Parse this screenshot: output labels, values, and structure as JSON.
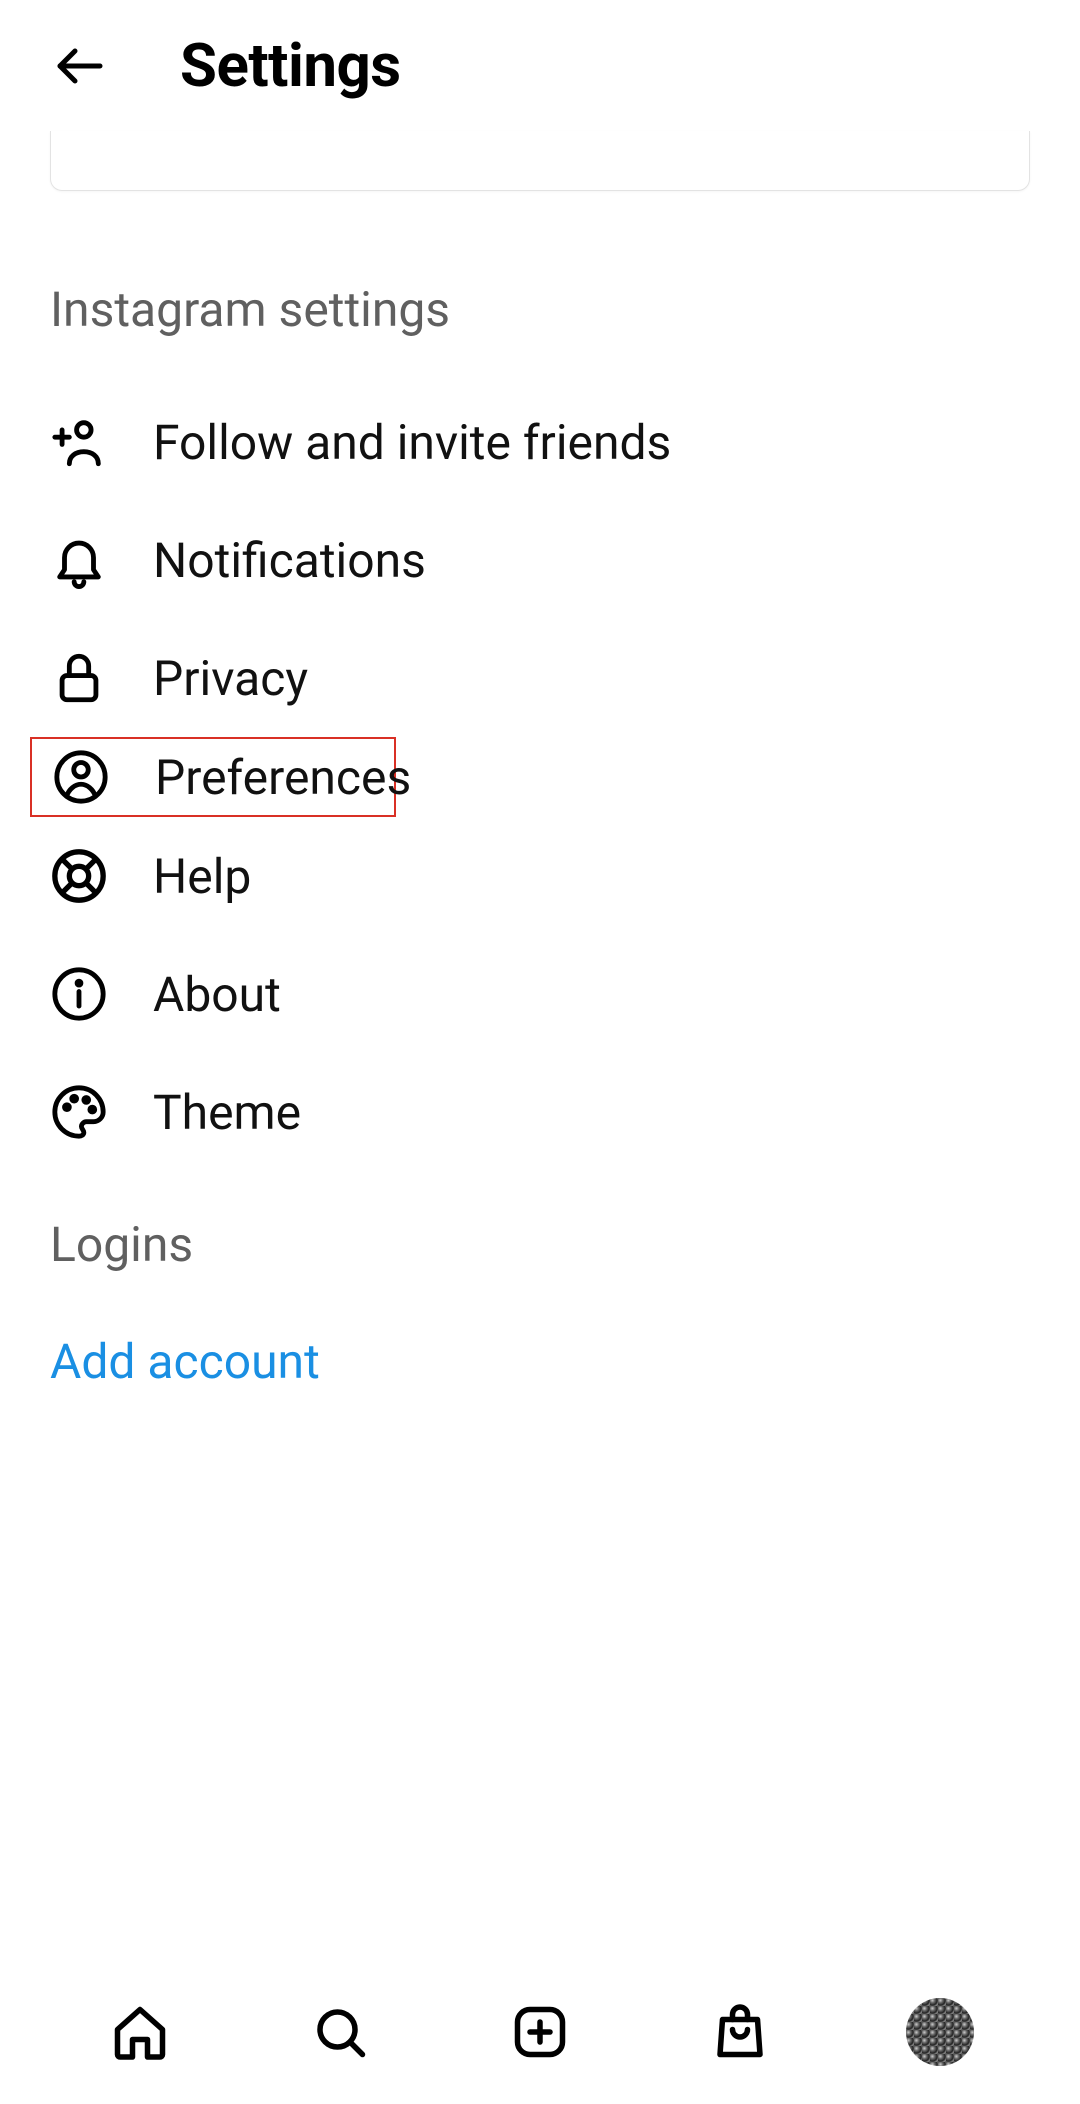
{
  "header": {
    "title": "Settings"
  },
  "section_header": "Instagram settings",
  "items": [
    {
      "name": "follow-invite",
      "label": "Follow and invite friends",
      "icon": "add-person-icon"
    },
    {
      "name": "notifications",
      "label": "Notifications",
      "icon": "bell-icon"
    },
    {
      "name": "privacy",
      "label": "Privacy",
      "icon": "lock-icon"
    },
    {
      "name": "preferences",
      "label": "Preferences",
      "icon": "person-circle-icon"
    },
    {
      "name": "help",
      "label": "Help",
      "icon": "lifebuoy-icon"
    },
    {
      "name": "about",
      "label": "About",
      "icon": "info-icon"
    },
    {
      "name": "theme",
      "label": "Theme",
      "icon": "palette-icon"
    }
  ],
  "logins_header": "Logins",
  "add_account_label": "Add account",
  "highlight_index": 3
}
